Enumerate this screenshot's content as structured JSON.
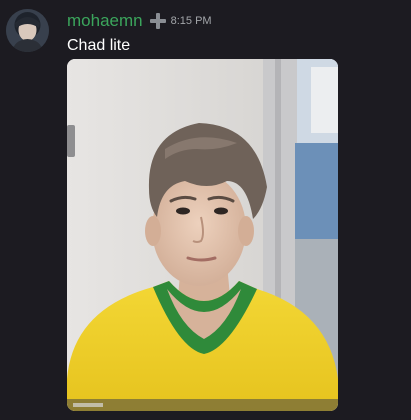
{
  "message": {
    "username": "mohaemn",
    "timestamp": "8:15 PM",
    "content": "Chad lite",
    "avatar_icon": "user-avatar",
    "role_icon": "plus-icon"
  },
  "attachment": {
    "kind": "image"
  },
  "colors": {
    "background": "#1c1b21",
    "username": "#3ba55c",
    "timestamp": "#a3a6aa",
    "content_text": "#ffffff"
  }
}
